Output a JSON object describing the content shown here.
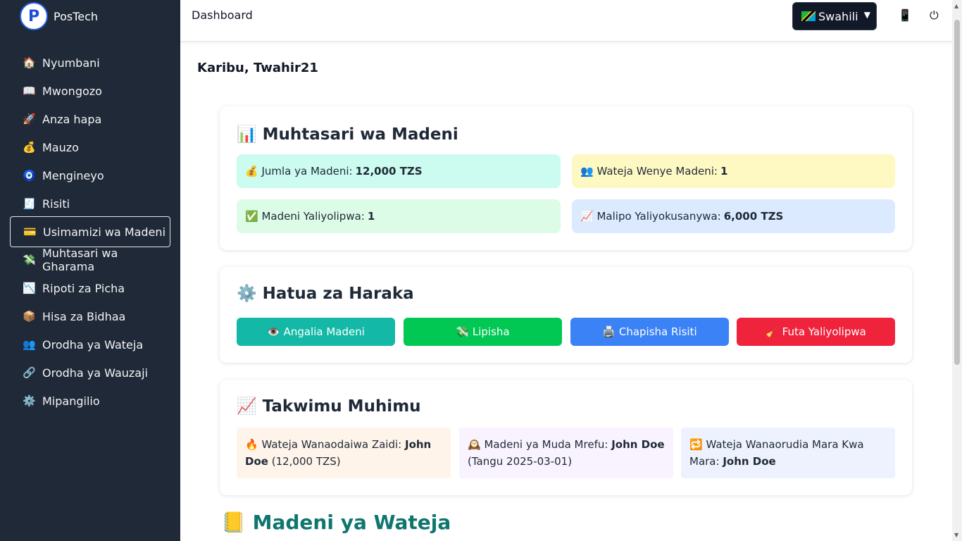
{
  "brand": {
    "name": "PosTech",
    "logo_letter": "P"
  },
  "sidebar": {
    "items": [
      {
        "icon": "🏠",
        "icon_name": "home-icon",
        "label": "Nyumbani"
      },
      {
        "icon": "📖",
        "icon_name": "book-icon",
        "label": "Mwongozo"
      },
      {
        "icon": "🚀",
        "icon_name": "rocket-icon",
        "label": "Anza hapa"
      },
      {
        "icon": "💰",
        "icon_name": "money-bag-icon",
        "label": "Mauzo"
      },
      {
        "icon": "🧿",
        "icon_name": "nazar-icon",
        "label": "Mengineyo"
      },
      {
        "icon": "🧾",
        "icon_name": "receipt-icon",
        "label": "Risiti"
      },
      {
        "icon": "💳",
        "icon_name": "credit-card-icon",
        "label": "Usimamizi wa Madeni"
      },
      {
        "icon": "💸",
        "icon_name": "money-wings-icon",
        "label": "Muhtasari wa Gharama"
      },
      {
        "icon": "📉",
        "icon_name": "chart-down-icon",
        "label": "Ripoti za Picha"
      },
      {
        "icon": "📦",
        "icon_name": "package-icon",
        "label": "Hisa za Bidhaa"
      },
      {
        "icon": "👥",
        "icon_name": "users-icon",
        "label": "Orodha ya Wateja"
      },
      {
        "icon": "🔗",
        "icon_name": "link-icon",
        "label": "Orodha ya Wauzaji"
      },
      {
        "icon": "⚙️",
        "icon_name": "gear-icon",
        "label": "Mipangilio"
      }
    ],
    "active_index": 6
  },
  "topbar": {
    "title": "Dashboard",
    "language": "Swahili",
    "icons": {
      "phone": "📱",
      "power": "⏻"
    }
  },
  "welcome": "Karibu, Twahir21",
  "summary": {
    "icon": "📊",
    "title": "Muhtasari wa Madeni",
    "stats": [
      {
        "icon": "💰",
        "label": "Jumla ya Madeni:",
        "value": "12,000 TZS",
        "color": "#ccfbef"
      },
      {
        "icon": "👥",
        "label": "Wateja Wenye Madeni:",
        "value": "1",
        "color": "#fef9c3"
      },
      {
        "icon": "✅",
        "label": "Madeni Yaliyolipwa:",
        "value": "1",
        "color": "#dcfce7"
      },
      {
        "icon": "📈",
        "label": "Malipo Yaliyokusanywa:",
        "value": "6,000 TZS",
        "color": "#dbeafe"
      }
    ]
  },
  "actions": {
    "icon": "⚙️",
    "title": "Hatua za Haraka",
    "buttons": [
      {
        "icon": "👁️",
        "label": "Angalia Madeni",
        "color": "#14b8a6"
      },
      {
        "icon": "💸",
        "label": "Lipisha",
        "color": "#00c853"
      },
      {
        "icon": "🖨️",
        "label": "Chapisha Risiti",
        "color": "#3b82f6"
      },
      {
        "icon": "🧹",
        "label": "Futa Yaliyolipwa",
        "color": "#ef233c"
      }
    ]
  },
  "stats": {
    "icon": "📈",
    "title": "Takwimu Muhimu",
    "items": [
      {
        "icon": "🔥",
        "label": "Wateja Wanaodaiwa Zaidi:",
        "value": "John Doe",
        "extra": "(12,000 TZS)",
        "color": "#fff4ea"
      },
      {
        "icon": "🕰️",
        "label": "Madeni ya Muda Mrefu:",
        "value": "John Doe",
        "extra": "(Tangu 2025-03-01)",
        "color": "#f8f3ff"
      },
      {
        "icon": "🔁",
        "label": "Wateja Wanaorudia Mara Kwa Mara:",
        "value": "John Doe",
        "extra": "",
        "color": "#eef2ff"
      }
    ]
  },
  "customer_debts": {
    "icon": "📒",
    "title": "Madeni ya Wateja"
  }
}
